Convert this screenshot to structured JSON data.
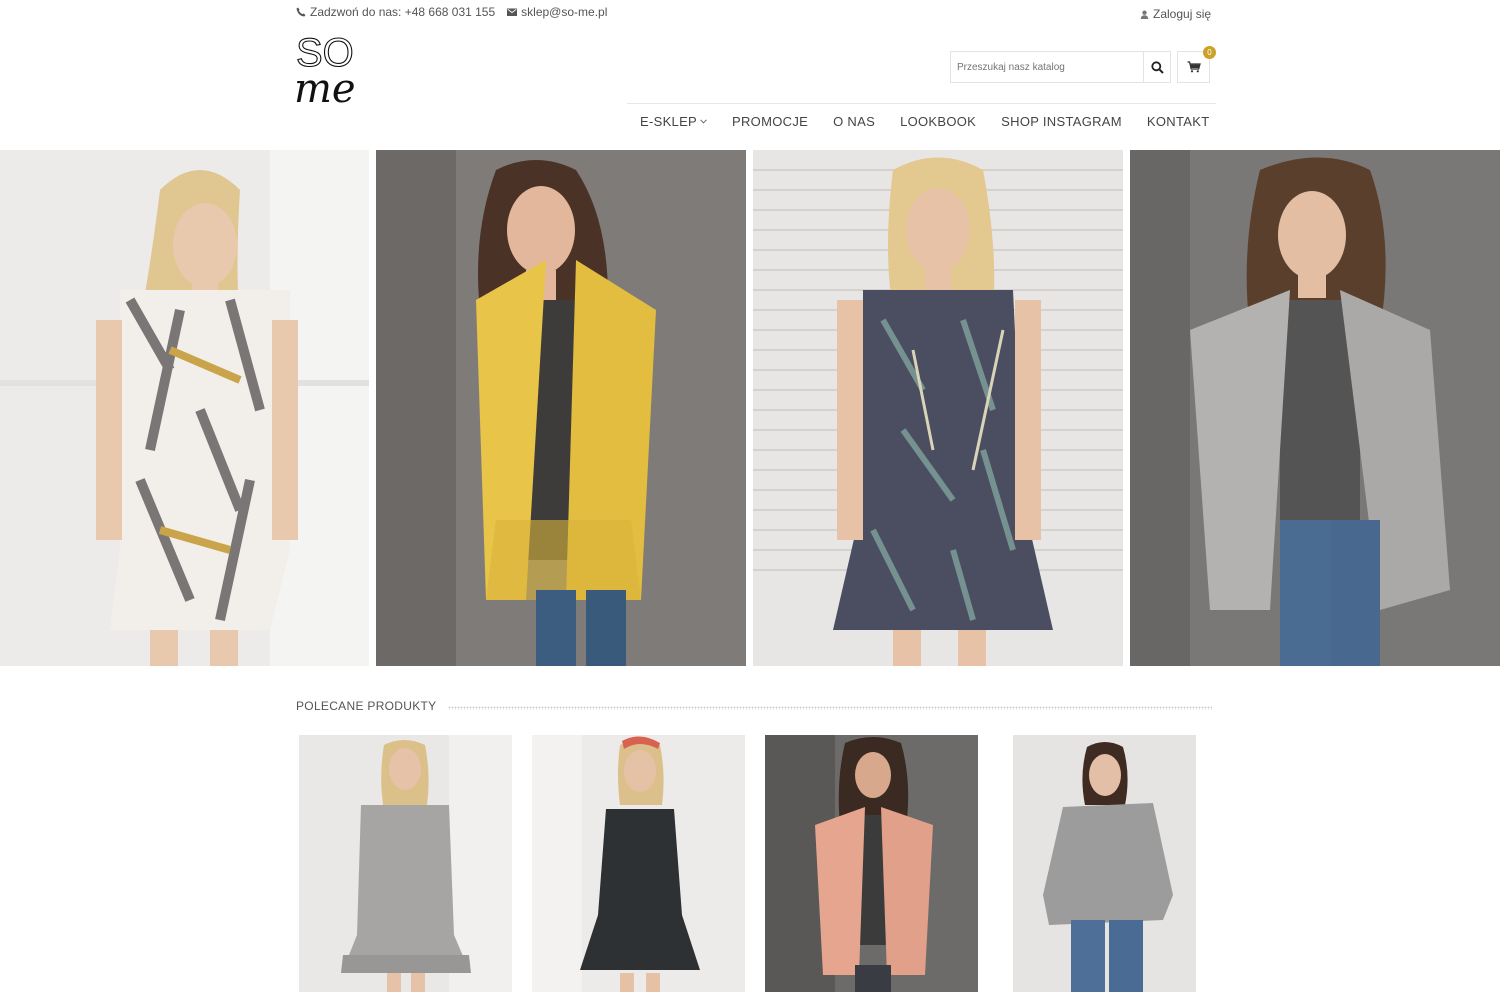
{
  "header": {
    "phone_text": "Zadzwoń do nas: +48 668 031 155",
    "email_text": "sklep@so-me.pl",
    "login_text": "Zaloguj się",
    "logo_text_top": "SO",
    "logo_text_bottom": "me",
    "search_placeholder": "Przeszukaj nasz katalog",
    "cart_count": "0"
  },
  "nav": {
    "items": [
      {
        "label": "E-SKLEP",
        "has_dropdown": true
      },
      {
        "label": "PROMOCJE"
      },
      {
        "label": "O NAS"
      },
      {
        "label": "LOOKBOOK"
      },
      {
        "label": "SHOP INSTAGRAM"
      },
      {
        "label": "KONTAKT"
      }
    ]
  },
  "hero": {
    "images": [
      {
        "subject": "model in white dress with leaf print"
      },
      {
        "subject": "model in yellow cable-knit cardigan"
      },
      {
        "subject": "model in navy palm-print dress"
      },
      {
        "subject": "model in grey cardigan and jeans"
      }
    ]
  },
  "recommended": {
    "title": "POLECANE PRODUKTY",
    "products": [
      {
        "subject": "grey ruffle-hem dress"
      },
      {
        "subject": "black sleeveless ruffle dress"
      },
      {
        "subject": "peach knit cardigan"
      },
      {
        "subject": "grey off-shoulder sweater"
      }
    ]
  },
  "colors": {
    "accent": "#c9a227",
    "text": "#444444",
    "border": "#e3e3e3"
  }
}
